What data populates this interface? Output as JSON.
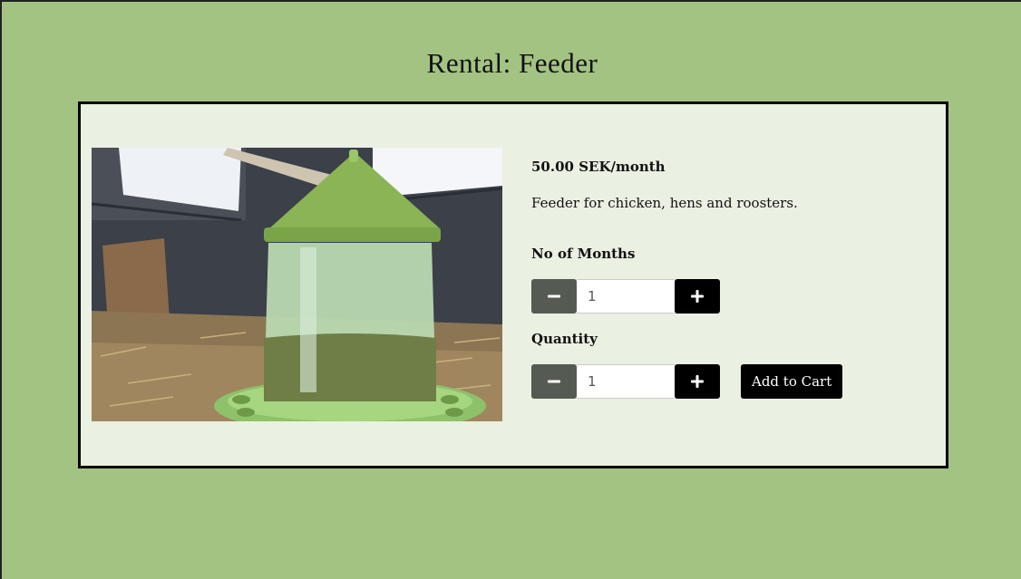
{
  "page": {
    "title": "Rental: Feeder"
  },
  "product": {
    "image_alt": "Feeder",
    "price": "50.00 SEK/month",
    "description": "Feeder for chicken, hens and roosters."
  },
  "months": {
    "label": "No of Months",
    "value": "1",
    "decrement_icon": "minus-icon",
    "increment_icon": "plus-icon"
  },
  "quantity": {
    "label": "Quantity",
    "value": "1",
    "decrement_icon": "minus-icon",
    "increment_icon": "plus-icon"
  },
  "cart": {
    "add_label": "Add to Cart"
  },
  "colors": {
    "page_background": "#a3c383",
    "card_background": "#eaf0e2",
    "minus_button": "#555a52",
    "plus_button": "#000000"
  }
}
